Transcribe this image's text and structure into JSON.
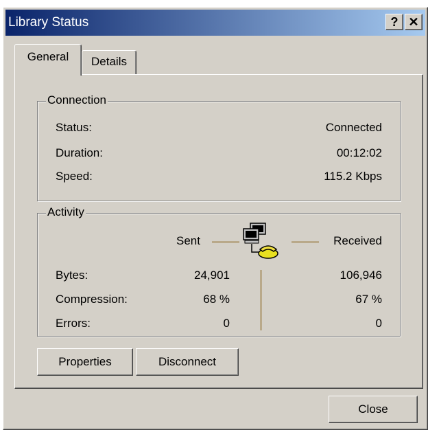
{
  "window": {
    "title": "Library Status",
    "help_glyph": "?",
    "close_glyph": "✕"
  },
  "tabs": [
    {
      "label": "General",
      "selected": true
    },
    {
      "label": "Details",
      "selected": false
    }
  ],
  "connection": {
    "group_label": "Connection",
    "rows": [
      {
        "label": "Status:",
        "value": "Connected"
      },
      {
        "label": "Duration:",
        "value": "00:12:02"
      },
      {
        "label": "Speed:",
        "value": "115.2 Kbps"
      }
    ]
  },
  "activity": {
    "group_label": "Activity",
    "sent_label": "Sent",
    "received_label": "Received",
    "icon": "network-computers-phone-icon",
    "rows": [
      {
        "label": "Bytes:",
        "sent": "24,901",
        "received": "106,946"
      },
      {
        "label": "Compression:",
        "sent": "68 %",
        "received": "67 %"
      },
      {
        "label": "Errors:",
        "sent": "0",
        "received": "0"
      }
    ]
  },
  "buttons": {
    "properties": "Properties",
    "disconnect": "Disconnect",
    "close": "Close"
  },
  "colors": {
    "titlebar_start": "#0a246a",
    "titlebar_end": "#a6caf0",
    "face": "#d4d0c8",
    "activity_line": "#b9a98a"
  }
}
